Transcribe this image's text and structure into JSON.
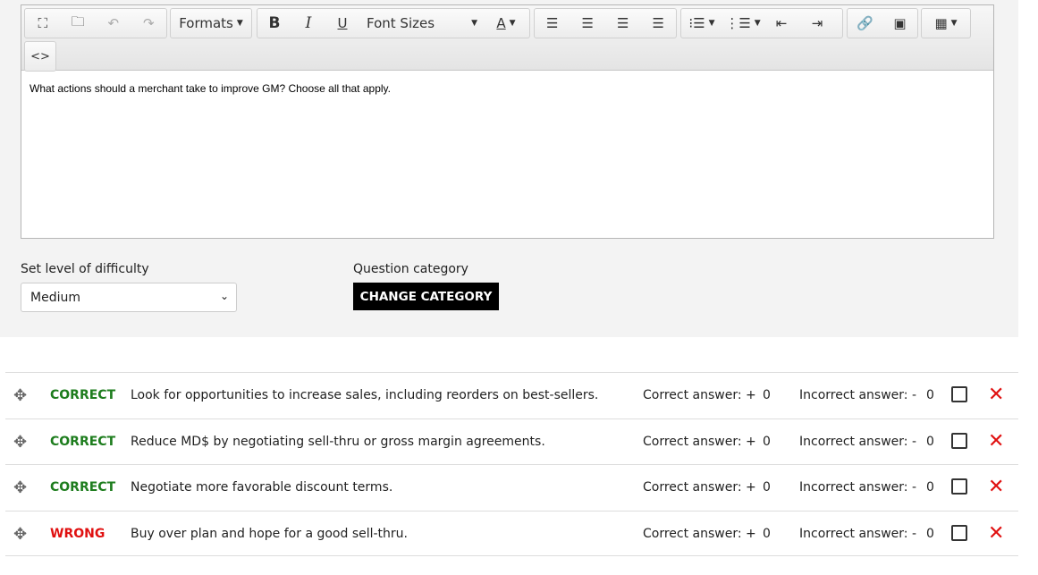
{
  "toolbar": {
    "formats_label": "Formats",
    "font_sizes_label": "Font Sizes",
    "bold": "B",
    "italic": "I",
    "underline": "U",
    "text_color": "A",
    "code": "<>"
  },
  "editor": {
    "content": "What actions should a merchant take to improve GM?  Choose all that apply."
  },
  "difficulty": {
    "label": "Set level of difficulty",
    "value": "Medium"
  },
  "category": {
    "label": "Question category",
    "button": "CHANGE CATEGORY"
  },
  "answers": [
    {
      "status": "CORRECT",
      "text": "Look for opportunities to increase sales, including reorders on best-sellers.",
      "correct_label": "Correct answer: +",
      "correct_value": "0",
      "incorrect_label": "Incorrect answer: -",
      "incorrect_value": "0"
    },
    {
      "status": "CORRECT",
      "text": "Reduce MD$ by negotiating sell-thru or gross margin agreements.",
      "correct_label": "Correct answer: +",
      "correct_value": "0",
      "incorrect_label": "Incorrect answer: -",
      "incorrect_value": "0"
    },
    {
      "status": "CORRECT",
      "text": "Negotiate more favorable discount terms.",
      "correct_label": "Correct answer: +",
      "correct_value": "0",
      "incorrect_label": "Incorrect answer: -",
      "incorrect_value": "0"
    },
    {
      "status": "WRONG",
      "text": "Buy over plan and hope for a good sell-thru.",
      "correct_label": "Correct answer: +",
      "correct_value": "0",
      "incorrect_label": "Incorrect answer: -",
      "incorrect_value": "0"
    }
  ]
}
